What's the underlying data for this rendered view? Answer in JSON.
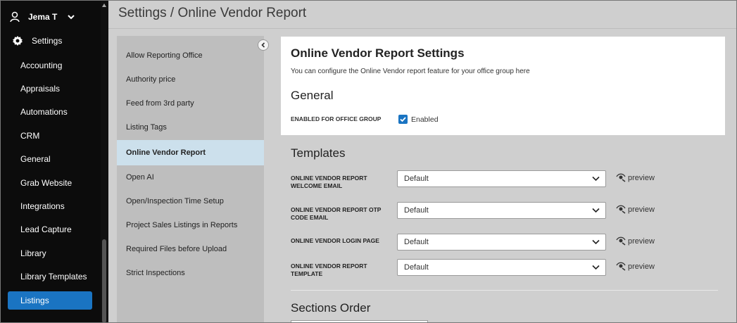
{
  "user": {
    "name": "Jema T"
  },
  "nav": {
    "settings_label": "Settings",
    "items": [
      {
        "label": "Accounting"
      },
      {
        "label": "Appraisals"
      },
      {
        "label": "Automations"
      },
      {
        "label": "CRM"
      },
      {
        "label": "General"
      },
      {
        "label": "Grab Website"
      },
      {
        "label": "Integrations"
      },
      {
        "label": "Lead Capture"
      },
      {
        "label": "Library"
      },
      {
        "label": "Library Templates"
      },
      {
        "label": "Listings"
      }
    ]
  },
  "page": {
    "title": "Settings / Online Vendor Report"
  },
  "subnav": {
    "items": [
      {
        "label": "Allow Reporting Office"
      },
      {
        "label": "Authority price"
      },
      {
        "label": "Feed from 3rd party"
      },
      {
        "label": "Listing Tags"
      },
      {
        "label": "Online Vendor Report"
      },
      {
        "label": "Open AI"
      },
      {
        "label": "Open/Inspection Time Setup"
      },
      {
        "label": "Project Sales Listings in Reports"
      },
      {
        "label": "Required Files before Upload"
      },
      {
        "label": "Strict Inspections"
      }
    ],
    "active": "Online Vendor Report"
  },
  "content": {
    "heading": "Online Vendor Report Settings",
    "description": "You can configure the Online Vendor report feature for your office group here",
    "general_title": "General",
    "enabled_label": "ENABLED FOR OFFICE GROUP",
    "enabled_checkbox": {
      "checked": true,
      "text": "Enabled"
    },
    "templates_title": "Templates",
    "templates": [
      {
        "label": "ONLINE VENDOR REPORT WELCOME EMAIL",
        "value": "Default",
        "preview": "preview"
      },
      {
        "label": "ONLINE VENDOR REPORT OTP CODE EMAIL",
        "value": "Default",
        "preview": "preview"
      },
      {
        "label": "ONLINE VENDOR LOGIN PAGE",
        "value": "Default",
        "preview": "preview"
      },
      {
        "label": "ONLINE VENDOR REPORT TEMPLATE",
        "value": "Default",
        "preview": "preview"
      }
    ],
    "sections_order_title": "Sections Order"
  },
  "colors": {
    "accent": "#1a74c2",
    "nav_bg": "#0c0c0c",
    "active_subnav": "#cce0ec"
  }
}
